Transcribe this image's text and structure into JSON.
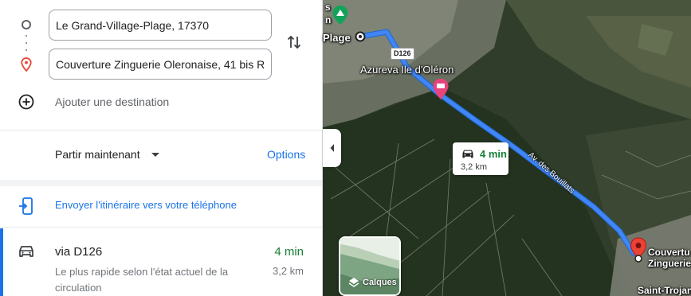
{
  "directions": {
    "start_value": "Le Grand-Village-Plage, 17370",
    "destination_value": "Couverture Zinguerie Oleronaise, 41 bis R",
    "add_destination_label": "Ajouter une destination",
    "depart_label": "Partir maintenant",
    "options_label": "Options",
    "send_to_phone_label": "Envoyer l'itinéraire vers votre téléphone"
  },
  "route": {
    "title": "via D126",
    "time": "4 min",
    "distance": "3,2 km",
    "description": "Le plus rapide selon l'état actuel de la circulation"
  },
  "map": {
    "labels": {
      "top_partial_1": "s",
      "top_partial_2": "n",
      "start_place": "Plage",
      "poi": "Azureva Ile d'Oléron",
      "road_badge": "D126",
      "avenue": "Av. des Bouillats",
      "destination_line1": "Couvertu",
      "destination_line2": "Zinguerie",
      "town": "Saint-Trojan-les-Ba"
    },
    "bubble_time": "4 min",
    "bubble_distance": "3,2 km",
    "layers_label": "Calques"
  },
  "colors": {
    "accent_blue": "#1a73e8",
    "route_line": "#4285f4",
    "time_green": "#188038",
    "destination_pin": "#ea4335",
    "poi_pink": "#e8437c"
  },
  "icons": [
    "start-circle-icon",
    "destination-pin-icon",
    "swap-icon",
    "add-circle-icon",
    "caret-down-icon",
    "phone-send-icon",
    "car-icon",
    "collapse-chevron-icon",
    "layers-icon",
    "campsite-icon",
    "hotel-icon"
  ]
}
